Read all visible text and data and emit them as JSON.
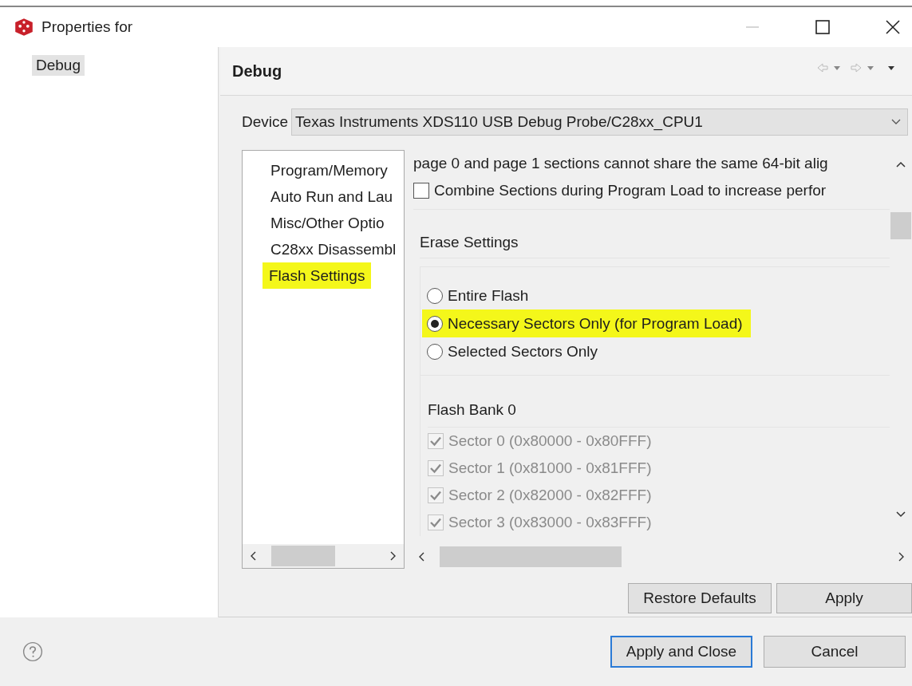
{
  "window": {
    "title": "Properties for"
  },
  "sidebar": {
    "items": [
      {
        "label": "Debug",
        "selected": true
      }
    ]
  },
  "page": {
    "title": "Debug",
    "device": {
      "label": "Device",
      "value": "Texas Instruments XDS110 USB Debug Probe/C28xx_CPU1"
    },
    "nav": [
      {
        "label": "Program/Memory",
        "highlighted": false
      },
      {
        "label": "Auto Run and Lau",
        "highlighted": false
      },
      {
        "label": "Misc/Other Optio",
        "highlighted": false
      },
      {
        "label": "C28xx Disassembl",
        "highlighted": false
      },
      {
        "label": "Flash Settings",
        "highlighted": true
      }
    ],
    "note": "page 0 and page 1 sections cannot share the same 64-bit alig",
    "combine": {
      "label": "Combine Sections during Program Load to increase perfor",
      "checked": false
    },
    "erase": {
      "title": "Erase Settings",
      "options": [
        {
          "label": "Entire Flash",
          "selected": false,
          "highlighted": false
        },
        {
          "label": "Necessary Sectors Only (for Program Load)",
          "selected": true,
          "highlighted": true
        },
        {
          "label": "Selected Sectors Only",
          "selected": false,
          "highlighted": false
        }
      ]
    },
    "bank": {
      "title": "Flash Bank 0",
      "sectors": [
        {
          "label": "Sector 0 (0x80000 - 0x80FFF)",
          "checked": true,
          "disabled": true
        },
        {
          "label": "Sector 1 (0x81000 - 0x81FFF)",
          "checked": true,
          "disabled": true
        },
        {
          "label": "Sector 2 (0x82000 - 0x82FFF)",
          "checked": true,
          "disabled": true
        },
        {
          "label": "Sector 3 (0x83000 - 0x83FFF)",
          "checked": true,
          "disabled": true
        }
      ]
    },
    "buttons": [
      "Restore Defaults",
      "Apply"
    ]
  },
  "footer": {
    "buttons": [
      {
        "label": "Apply and Close",
        "default": true
      },
      {
        "label": "Cancel",
        "default": false
      }
    ]
  }
}
